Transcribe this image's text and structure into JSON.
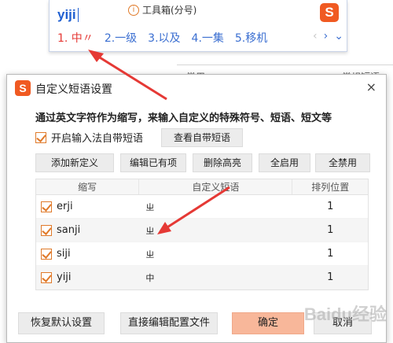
{
  "ime": {
    "input": "yiji",
    "tool_label": "工具箱(分号)",
    "logo": "S",
    "candidates": [
      "1. 中〃",
      "2.一级",
      "3.以及",
      "4.一集",
      "5.移机"
    ],
    "nav": [
      "‹",
      "›",
      "⌄"
    ]
  },
  "background": {
    "left_text": "常用",
    "right_text": "常规短语"
  },
  "dialog": {
    "title": "自定义短语设置",
    "close": "×",
    "description": "通过英文字符作为缩写，来输入自定义的特殊符号、短语、短文等",
    "enable_label": "开启输入法自带短语",
    "view_builtin": "查看自带短语",
    "toolbar": {
      "add": "添加新定义",
      "edit": "编辑已有项",
      "delete": "删除高亮",
      "enable_all": "全启用",
      "disable_all": "全禁用"
    },
    "table": {
      "headers": [
        "缩写",
        "自定义短语",
        "排列位置"
      ],
      "rows": [
        {
          "abbr": "erji",
          "phrase": "ㄓ",
          "pos": "1"
        },
        {
          "abbr": "sanji",
          "phrase": "ㄓ",
          "pos": "1"
        },
        {
          "abbr": "siji",
          "phrase": "ㄓ",
          "pos": "1"
        },
        {
          "abbr": "yiji",
          "phrase": "中",
          "pos": "1"
        }
      ]
    },
    "footer": {
      "restore": "恢复默认设置",
      "direct_edit": "直接编辑配置文件",
      "ok": "确定",
      "cancel": "取消"
    }
  },
  "watermark": "Baidu经验",
  "colors": {
    "accent": "#f05a22",
    "candidate_blue": "#3b6fd1",
    "arrow_red": "#e53935"
  }
}
